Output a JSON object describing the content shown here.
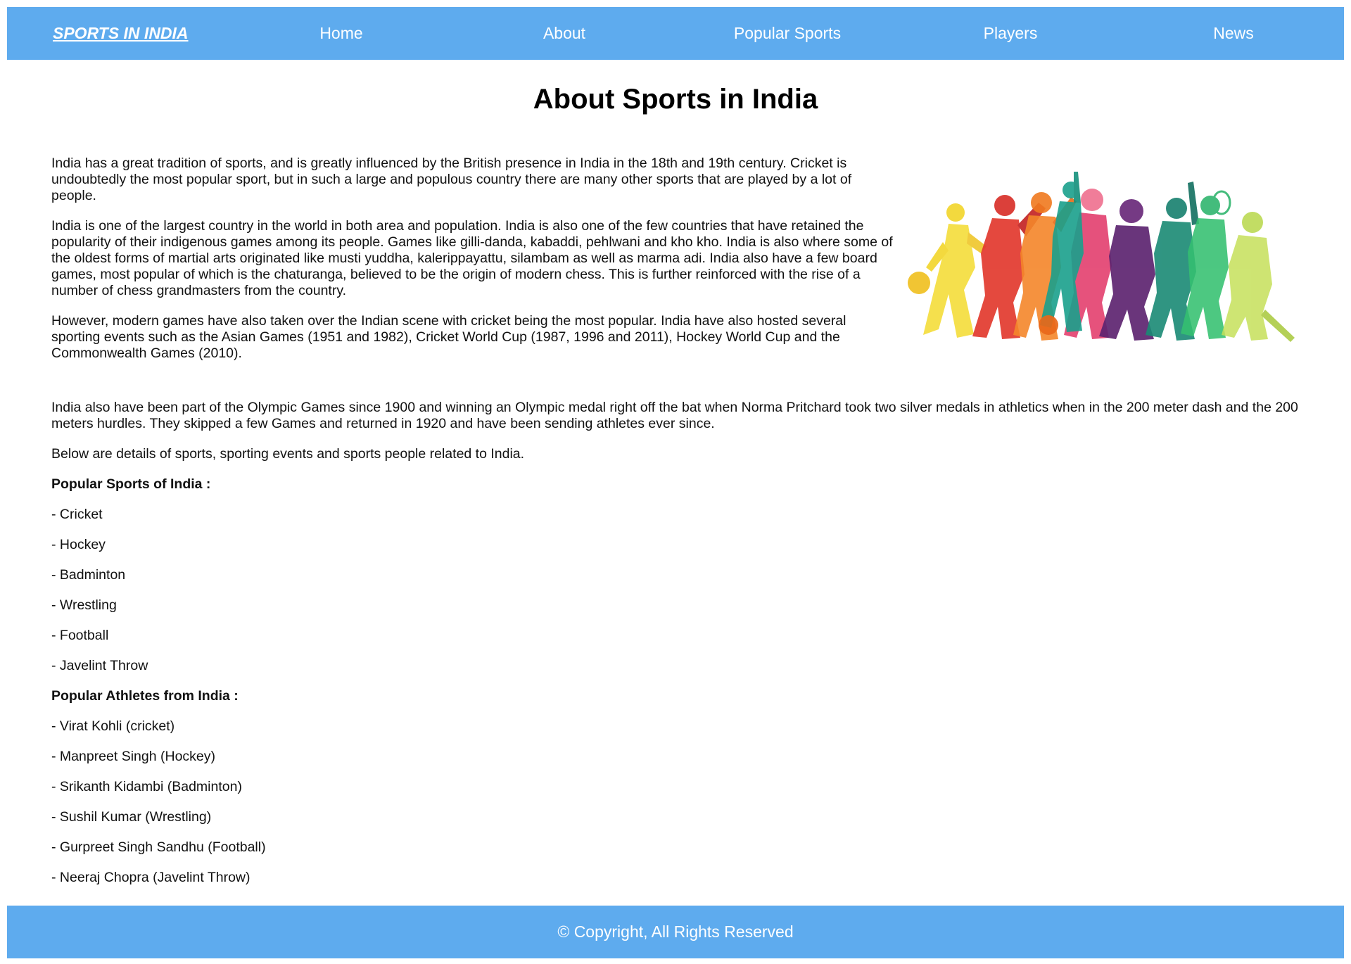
{
  "nav": {
    "brand": "SPORTS IN INDIA",
    "links": [
      "Home",
      "About",
      "Popular Sports",
      "Players",
      "News"
    ]
  },
  "page_title": "About Sports in India",
  "intro_paragraphs": [
    "India has a great tradition of sports, and is greatly influenced by the British presence in India in the 18th and 19th century. Cricket is undoubtedly the most popular sport, but in such a large and populous country there are many other sports that are played by a lot of people.",
    "India is one of the largest country in the world in both area and population. India is also one of the few countries that have retained the popularity of their indigenous games among its people. Games like gilli-danda, kabaddi, pehlwani and kho kho. India is also where some of the oldest forms of martial arts originated like musti yuddha, kalerippayattu, silambam as well as marma adi. India also have a few board games, most popular of which is the chaturanga, believed to be the origin of modern chess. This is further reinforced with the rise of a number of chess grandmasters from the country.",
    "However, modern games have also taken over the Indian scene with cricket being the most popular. India have also hosted several sporting events such as the Asian Games (1951 and 1982), Cricket World Cup (1987, 1996 and 2011), Hockey World Cup and the Commonwealth Games (2010)."
  ],
  "olympic_paragraph": "India also have been part of the Olympic Games since 1900 and winning an Olympic medal right off the bat when Norma Pritchard took two silver medals in athletics when in the 200 meter dash and the 200 meters hurdles. They skipped a few Games and returned in 1920 and have been sending athletes ever since.",
  "details_intro": "Below are details of sports, sporting events and sports people related to India.",
  "popular_sports": {
    "heading": "Popular Sports of India :",
    "items": [
      "- Cricket",
      "- Hockey",
      "- Badminton",
      "- Wrestling",
      "- Football",
      "- Javelint Throw"
    ]
  },
  "popular_athletes": {
    "heading": "Popular Athletes from India :",
    "items": [
      "- Virat Kohli (cricket)",
      "- Manpreet Singh (Hockey)",
      "- Srikanth Kidambi (Badminton)",
      "- Sushil Kumar (Wrestling)",
      "- Gurpreet Singh Sandhu (Football)",
      "- Neeraj Chopra (Javelint Throw)"
    ]
  },
  "footer": {
    "text": "© Copyright, All Rights Reserved"
  },
  "colors": {
    "bar_background": "#5eabee",
    "bar_text": "#ffffff",
    "body_text": "#111111"
  },
  "hero_image": {
    "icon": "sports-silhouettes-illustration",
    "palette": [
      "#f2d52a",
      "#e8432e",
      "#f07a1f",
      "#e23a6a",
      "#1aa08c",
      "#6a2a7a",
      "#2bb36a",
      "#b8d84a"
    ]
  }
}
